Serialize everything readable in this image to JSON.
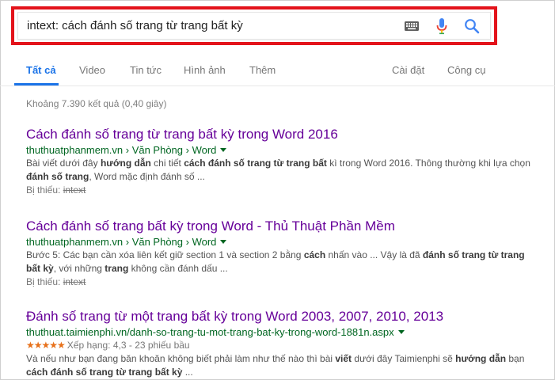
{
  "search": {
    "query": "intext: cách đánh số trang từ trang bất kỳ"
  },
  "tabs": {
    "items": [
      "Tất cả",
      "Video",
      "Tin tức",
      "Hình ảnh",
      "Thêm"
    ],
    "right": [
      "Cài đặt",
      "Công cụ"
    ]
  },
  "stats": "Khoảng 7.390 kết quả (0,40 giây)",
  "results": [
    {
      "title": "Cách đánh số trang từ trang bất kỳ trong Word 2016",
      "url": "thuthuatphanmem.vn › Văn Phòng › Word",
      "snippet": [
        {
          "t": "Bài viết dưới đây "
        },
        {
          "b": "hướng dẫn"
        },
        {
          "t": " chi tiết "
        },
        {
          "b": "cách đánh số trang từ trang bất"
        },
        {
          "t": " kì trong Word 2016. Thông thường khi lựa chọn "
        },
        {
          "b": "đánh số trang"
        },
        {
          "t": ", Word mặc định đánh số ..."
        }
      ],
      "missing_label": "Bị thiếu:",
      "missing_term": "intext"
    },
    {
      "title": "Cách đánh số trang bất kỳ trong Word - Thủ Thuật Phần Mềm",
      "url": "thuthuatphanmem.vn › Văn Phòng › Word",
      "snippet": [
        {
          "t": "Bước 5: Các bạn cần xóa liên kết giữ section 1 và section 2 bằng "
        },
        {
          "b": "cách"
        },
        {
          "t": " nhấn vào ... Vậy là đã "
        },
        {
          "b": "đánh số trang từ trang bất kỳ"
        },
        {
          "t": ", với những "
        },
        {
          "b": "trang"
        },
        {
          "t": " không cần đánh dấu ..."
        }
      ],
      "missing_label": "Bị thiếu:",
      "missing_term": "intext"
    },
    {
      "title": "Đánh số trang từ một trang bất kỳ trong Word 2003, 2007, 2010, 2013",
      "url": "thuthuat.taimienphi.vn/danh-so-trang-tu-mot-trang-bat-ky-trong-word-1881n.aspx",
      "rating_stars": "★★★★★",
      "rating": 4.3,
      "rating_text": "Xếp hạng: 4,3 - 23 phiếu bầu",
      "snippet": [
        {
          "t": "Và nếu như bạn đang băn khoăn không biết phải làm như thế nào thì bài "
        },
        {
          "b": "viết"
        },
        {
          "t": " dưới đây Taimienphi sẽ "
        },
        {
          "b": "hướng dẫn"
        },
        {
          "t": " bạn "
        },
        {
          "b": "cách đánh số trang từ trang bất kỳ"
        },
        {
          "t": " ..."
        }
      ]
    }
  ],
  "colors": {
    "highlight_border": "#e3131b",
    "link_visited": "#660099",
    "url_green": "#006621",
    "tab_active": "#1a73e8",
    "star": "#e7711b"
  }
}
